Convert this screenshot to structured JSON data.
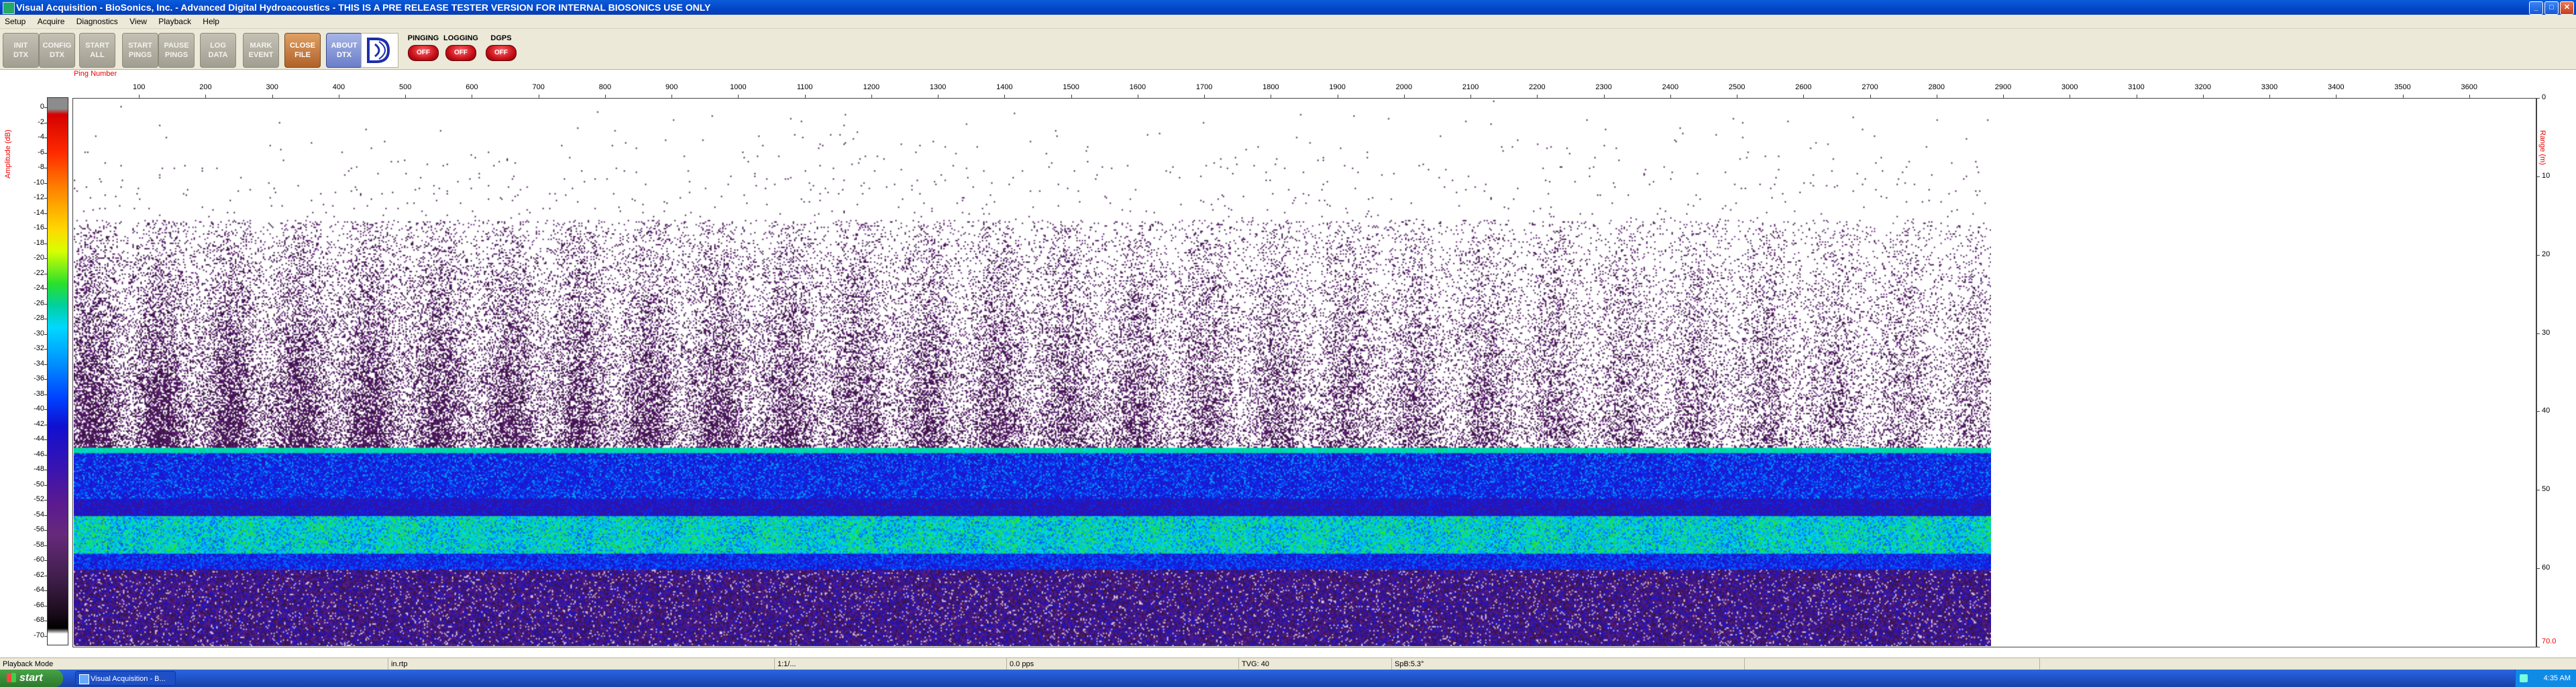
{
  "window": {
    "title": "Visual Acquisition  -  BioSonics, Inc.  -  Advanced Digital Hydroacoustics  -  THIS IS A PRE RELEASE TESTER VERSION FOR INTERNAL BIOSONICS USE ONLY",
    "minimize": "_",
    "maximize": "□",
    "close": "✕"
  },
  "menu": [
    "Setup",
    "Acquire",
    "Diagnostics",
    "View",
    "Playback",
    "Help"
  ],
  "toolbar": {
    "buttons": [
      {
        "label": "INIT\nDTX",
        "style": "gray"
      },
      {
        "label": "CONFIG\nDTX",
        "style": "gray"
      },
      {
        "label": "START\nALL",
        "style": "gray"
      },
      {
        "label": "START\nPINGS",
        "style": "gray"
      },
      {
        "label": "PAUSE\nPINGS",
        "style": "gray"
      },
      {
        "label": "LOG\nDATA",
        "style": "gray"
      },
      {
        "label": "MARK\nEVENT",
        "style": "gray"
      },
      {
        "label": "CLOSE\nFILE",
        "style": "orange"
      },
      {
        "label": "ABOUT\nDTX",
        "style": "blue"
      }
    ],
    "logo_icon": "biosonics-logo-icon",
    "status": [
      {
        "label": "PINGING",
        "state": "OFF"
      },
      {
        "label": "LOGGING",
        "state": "OFF"
      },
      {
        "label": "DGPS",
        "state": "OFF"
      }
    ]
  },
  "plot": {
    "amplitude_label": "Amplitude (dB)",
    "ping_number_label": "Ping Number",
    "range_label": "Range (m)",
    "colorbar_ticks": [
      "0",
      "-2",
      "-4",
      "-6",
      "-8",
      "-10",
      "-12",
      "-14",
      "-16",
      "-18",
      "-20",
      "-22",
      "-24",
      "-26",
      "-28",
      "-30",
      "-32",
      "-34",
      "-36",
      "-38",
      "-40",
      "-42",
      "-44",
      "-46",
      "-48",
      "-50",
      "-52",
      "-54",
      "-56",
      "-58",
      "-60",
      "-62",
      "-64",
      "-66",
      "-68",
      "-70"
    ],
    "ping_ticks": [
      "100",
      "200",
      "300",
      "400",
      "500",
      "600",
      "700",
      "800",
      "900",
      "1000",
      "1100",
      "1200",
      "1300",
      "1400",
      "1500",
      "1600",
      "1700",
      "1800",
      "1900",
      "2000",
      "2100",
      "2200",
      "2300",
      "2400",
      "2500",
      "2600",
      "2700",
      "2800",
      "2900",
      "3000",
      "3100",
      "3200",
      "3300",
      "3400",
      "3500",
      "3600"
    ],
    "ping_axis_max": 3700,
    "pings_recorded": 2880,
    "range_ticks": [
      "0",
      "10",
      "20",
      "30",
      "40",
      "50",
      "60",
      "70.0"
    ],
    "range_max": 70,
    "colors": {
      "seabed_green": "#28e02c",
      "water_blue": "#1030e8",
      "noise_purple": "#4a1a6e"
    }
  },
  "statusbar": {
    "mode": "Playback Mode",
    "ping_rate": "in.rtp",
    "time": "1:1/...",
    "pps": "0.0 pps",
    "tvg": "TVG: 40",
    "spb": "SpB:5.3°"
  },
  "taskbar": {
    "start": "start",
    "task_item": "Visual Acquisition  -  B...",
    "clock": "4:35 AM"
  }
}
